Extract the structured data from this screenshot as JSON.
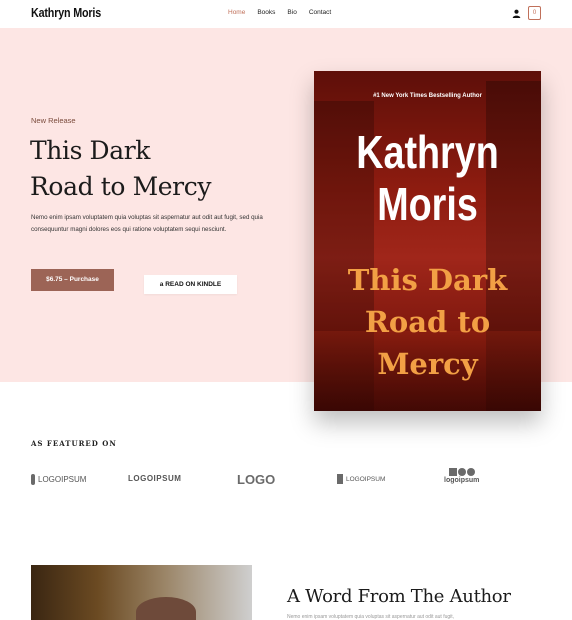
{
  "header": {
    "brand": "Kathryn Moris",
    "nav": [
      {
        "label": "Home",
        "active": true
      },
      {
        "label": "Books",
        "active": false
      },
      {
        "label": "Bio",
        "active": false
      },
      {
        "label": "Contact",
        "active": false
      }
    ],
    "cart_count": "0",
    "accent_color": "#c0705a"
  },
  "hero": {
    "eyebrow": "New Release",
    "title_line1": "This Dark",
    "title_line2": "Road to Mercy",
    "description": "Nemo enim ipsam voluptatem quia voluptas sit aspernatur aut odit aut fugit, sed quia consequuntur magni dolores eos qui ratione voluptatem sequi nesciunt.",
    "purchase_label": "$6.75 – Purchase",
    "kindle_label": "READ ON KINDLE",
    "kindle_icon": "a"
  },
  "book": {
    "tagline": "#1 New York Times Bestselling Author",
    "author_line1": "Kathryn",
    "author_line2": "Moris",
    "title_line1": "This Dark",
    "title_line2": "Road to",
    "title_line3": "Mercy"
  },
  "featured": {
    "heading": "AS FEATURED ON",
    "logos": [
      "LOGOIPSUM",
      "LOGOIPSUM",
      "LOGO",
      "LOGOIPSUM",
      "logoipsum"
    ]
  },
  "author_section": {
    "heading": "A Word From The Author",
    "snippet": "Nemo enim ipsam voluptatem quia voluptas sit aspernatur aut odit aut fugit,"
  }
}
